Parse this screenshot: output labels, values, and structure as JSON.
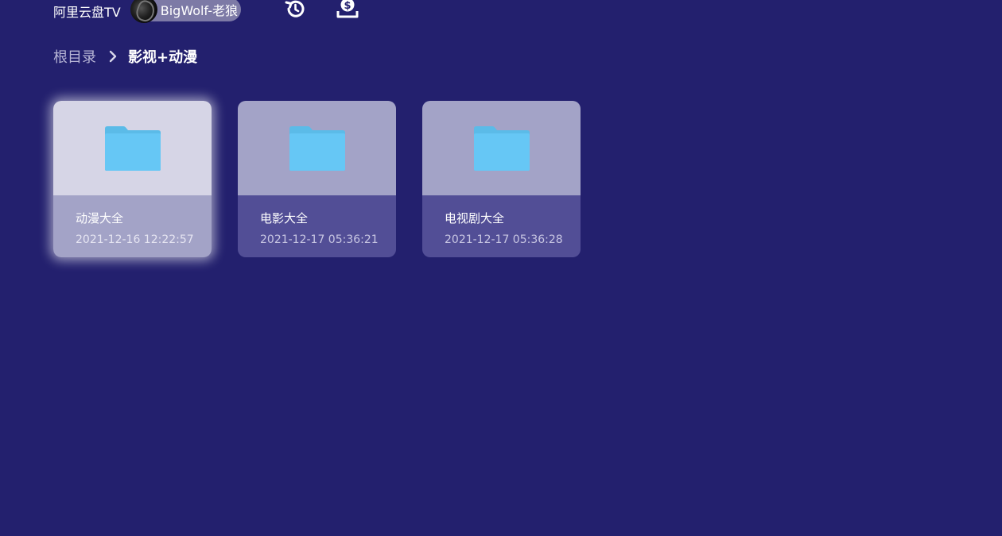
{
  "header": {
    "app_title": "阿里云盘TV",
    "user_name": "BigWolf-老狼",
    "icons": [
      "history-icon",
      "download-icon"
    ]
  },
  "breadcrumb": {
    "root": "根目录",
    "current": "影视+动漫"
  },
  "folders": [
    {
      "name": "动漫大全",
      "date": "2021-12-16 12:22:57",
      "focused": true
    },
    {
      "name": "电影大全",
      "date": "2021-12-17 05:36:21",
      "focused": false
    },
    {
      "name": "电视剧大全",
      "date": "2021-12-17 05:36:28",
      "focused": false
    }
  ],
  "colors": {
    "background": "#23206e",
    "card_thumb": "#a3a3c7",
    "card_info": "#524e96",
    "folder": "#66c7f5"
  }
}
